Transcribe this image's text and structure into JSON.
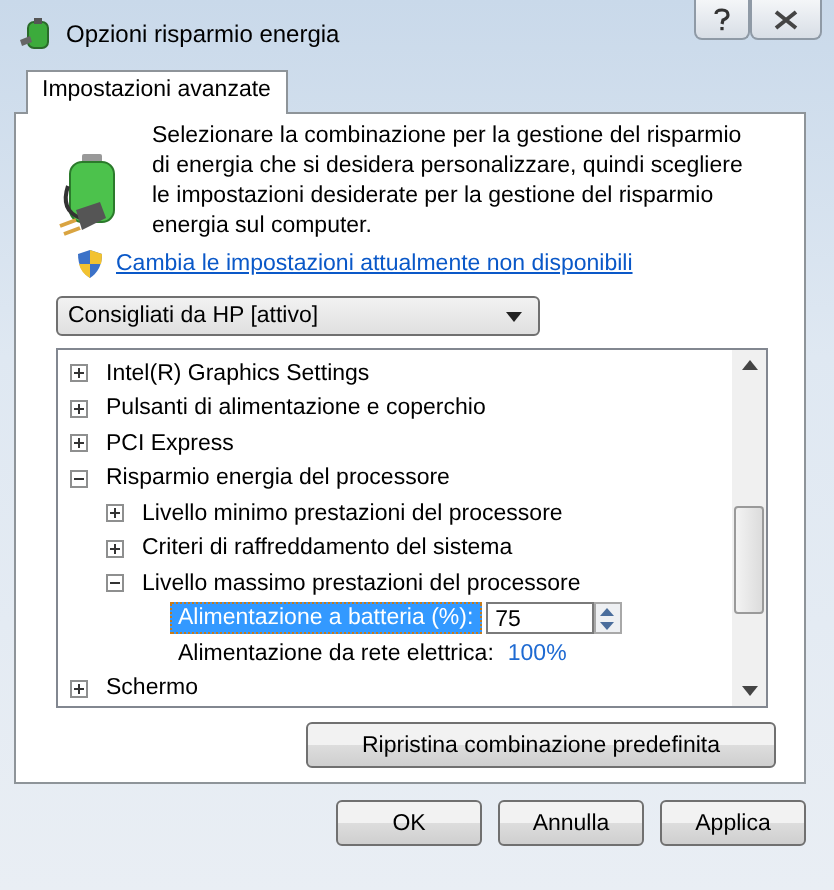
{
  "window": {
    "title": "Opzioni risparmio energia"
  },
  "tabs": [
    {
      "label": "Impostazioni avanzate",
      "selected": true
    }
  ],
  "description": "Selezionare la combinazione per la gestione del risparmio di energia che si desidera personalizzare, quindi scegliere le impostazioni desiderate per la gestione del risparmio energia sul computer.",
  "link": "Cambia le impostazioni attualmente non disponibili",
  "plan_dropdown": {
    "value": "Consigliati da HP [attivo]"
  },
  "tree": [
    {
      "kind": "node",
      "label": "Intel(R) Graphics Settings",
      "expanded": false
    },
    {
      "kind": "node",
      "label": "Pulsanti di alimentazione e coperchio",
      "expanded": false
    },
    {
      "kind": "node",
      "label": "PCI Express",
      "expanded": false
    },
    {
      "kind": "node",
      "label": "Risparmio energia del processore",
      "expanded": true,
      "children": [
        {
          "kind": "node",
          "label": "Livello minimo prestazioni del processore",
          "expanded": false
        },
        {
          "kind": "node",
          "label": "Criteri di raffreddamento del sistema",
          "expanded": false
        },
        {
          "kind": "node",
          "label": "Livello massimo prestazioni del processore",
          "expanded": true,
          "children": [
            {
              "kind": "spin",
              "label": "Alimentazione a batteria (%):",
              "value": "75",
              "selected": true
            },
            {
              "kind": "reading",
              "label": "Alimentazione da rete elettrica:",
              "value": "100%",
              "selected": false
            }
          ]
        }
      ]
    },
    {
      "kind": "node",
      "label": "Schermo",
      "expanded": false
    }
  ],
  "restore_button": "Ripristina combinazione predefinita",
  "buttons": [
    "OK",
    "Annulla",
    "Applica"
  ]
}
